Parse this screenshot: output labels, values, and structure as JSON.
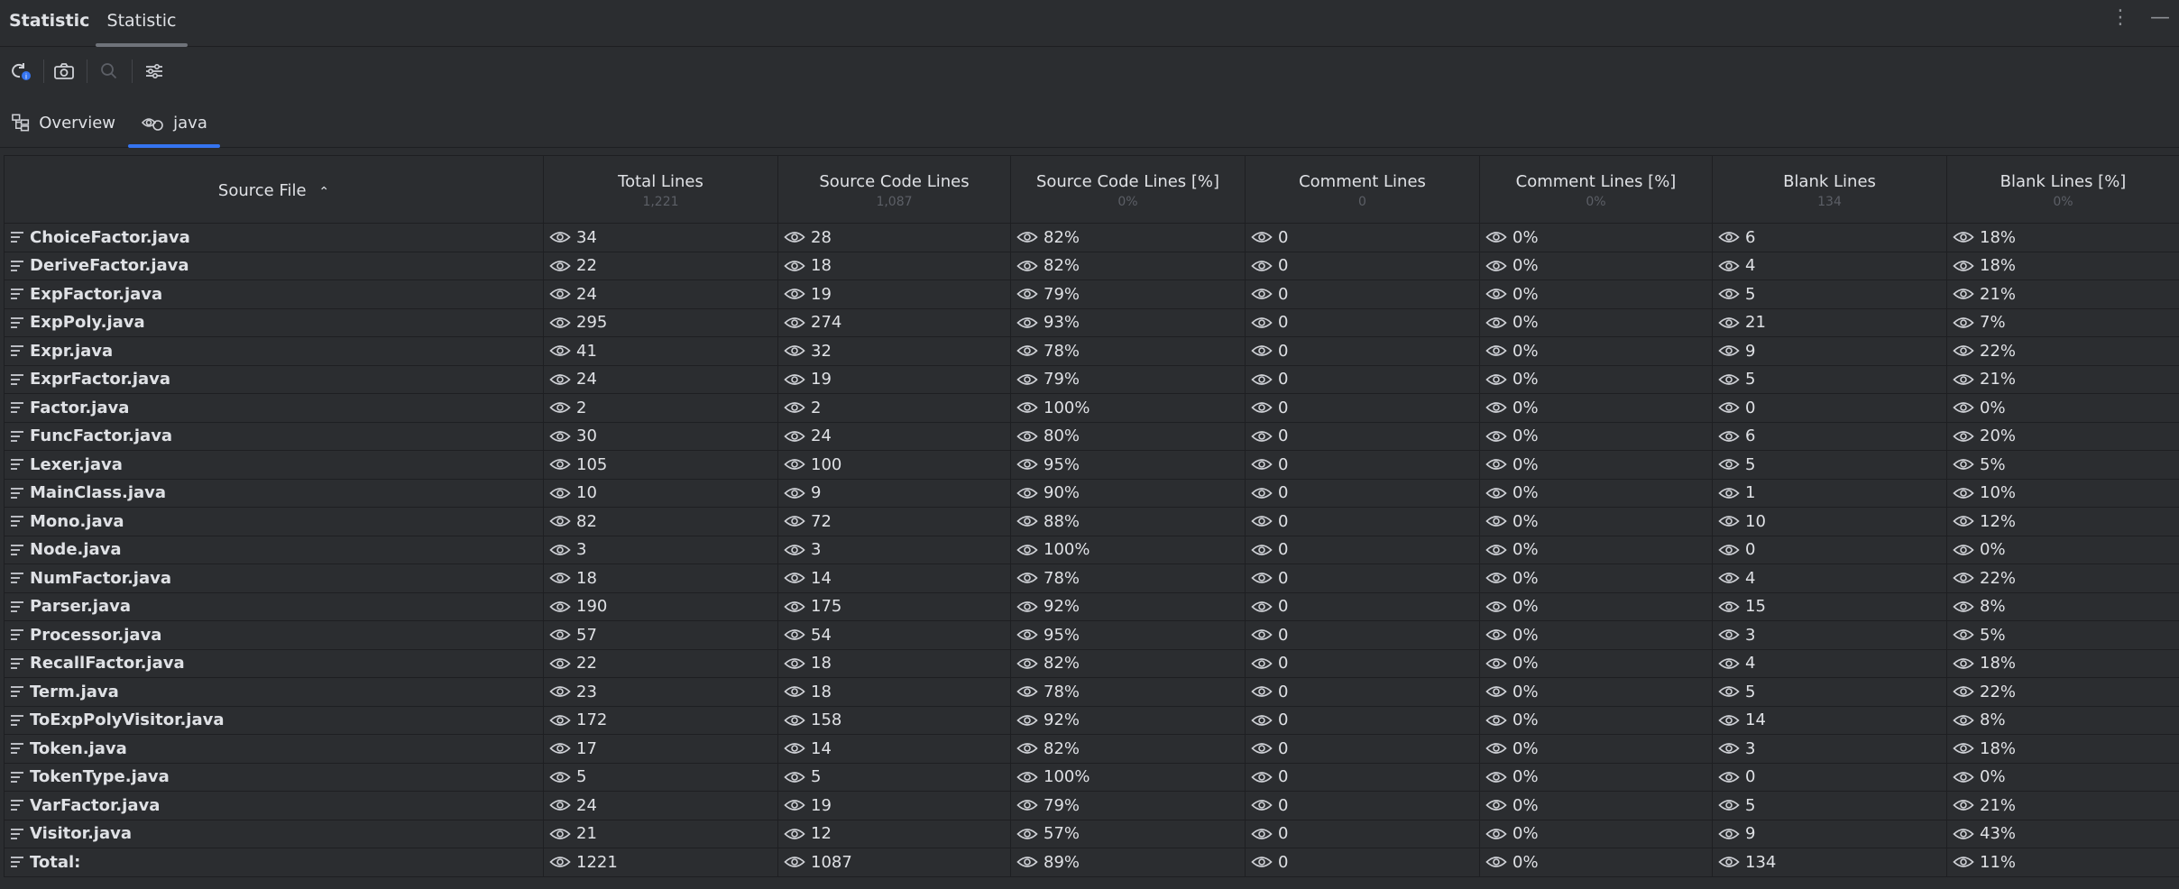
{
  "window": {
    "title": "Statistic",
    "tab": "Statistic",
    "more_icon": "more-vertical-icon",
    "minimize_icon": "minimize-icon"
  },
  "toolbar": {
    "refresh_icon": "refresh-icon",
    "snapshot_icon": "camera-icon",
    "search_icon": "search-icon",
    "settings_icon": "sliders-icon"
  },
  "subtabs": {
    "overview": "Overview",
    "java": "java"
  },
  "accent": "#3574f0",
  "table": {
    "headers": {
      "source_file": "Source File",
      "total_lines": "Total Lines",
      "total_lines_sub": "1,221",
      "source_code_lines": "Source Code Lines",
      "source_code_lines_sub": "1,087",
      "source_code_pct": "Source Code Lines [%]",
      "source_code_pct_sub": "0%",
      "comment_lines": "Comment Lines",
      "comment_lines_sub": "0",
      "comment_pct": "Comment Lines [%]",
      "comment_pct_sub": "0%",
      "blank_lines": "Blank Lines",
      "blank_lines_sub": "134",
      "blank_pct": "Blank Lines [%]",
      "blank_pct_sub": "0%"
    },
    "rows": [
      {
        "file": "ChoiceFactor.java",
        "total": "34",
        "src": "28",
        "src_pct": "82%",
        "com": "0",
        "com_pct": "0%",
        "blank": "6",
        "blank_pct": "18%"
      },
      {
        "file": "DeriveFactor.java",
        "total": "22",
        "src": "18",
        "src_pct": "82%",
        "com": "0",
        "com_pct": "0%",
        "blank": "4",
        "blank_pct": "18%"
      },
      {
        "file": "ExpFactor.java",
        "total": "24",
        "src": "19",
        "src_pct": "79%",
        "com": "0",
        "com_pct": "0%",
        "blank": "5",
        "blank_pct": "21%"
      },
      {
        "file": "ExpPoly.java",
        "total": "295",
        "src": "274",
        "src_pct": "93%",
        "com": "0",
        "com_pct": "0%",
        "blank": "21",
        "blank_pct": "7%"
      },
      {
        "file": "Expr.java",
        "total": "41",
        "src": "32",
        "src_pct": "78%",
        "com": "0",
        "com_pct": "0%",
        "blank": "9",
        "blank_pct": "22%"
      },
      {
        "file": "ExprFactor.java",
        "total": "24",
        "src": "19",
        "src_pct": "79%",
        "com": "0",
        "com_pct": "0%",
        "blank": "5",
        "blank_pct": "21%"
      },
      {
        "file": "Factor.java",
        "total": "2",
        "src": "2",
        "src_pct": "100%",
        "com": "0",
        "com_pct": "0%",
        "blank": "0",
        "blank_pct": "0%"
      },
      {
        "file": "FuncFactor.java",
        "total": "30",
        "src": "24",
        "src_pct": "80%",
        "com": "0",
        "com_pct": "0%",
        "blank": "6",
        "blank_pct": "20%"
      },
      {
        "file": "Lexer.java",
        "total": "105",
        "src": "100",
        "src_pct": "95%",
        "com": "0",
        "com_pct": "0%",
        "blank": "5",
        "blank_pct": "5%"
      },
      {
        "file": "MainClass.java",
        "total": "10",
        "src": "9",
        "src_pct": "90%",
        "com": "0",
        "com_pct": "0%",
        "blank": "1",
        "blank_pct": "10%"
      },
      {
        "file": "Mono.java",
        "total": "82",
        "src": "72",
        "src_pct": "88%",
        "com": "0",
        "com_pct": "0%",
        "blank": "10",
        "blank_pct": "12%"
      },
      {
        "file": "Node.java",
        "total": "3",
        "src": "3",
        "src_pct": "100%",
        "com": "0",
        "com_pct": "0%",
        "blank": "0",
        "blank_pct": "0%"
      },
      {
        "file": "NumFactor.java",
        "total": "18",
        "src": "14",
        "src_pct": "78%",
        "com": "0",
        "com_pct": "0%",
        "blank": "4",
        "blank_pct": "22%"
      },
      {
        "file": "Parser.java",
        "total": "190",
        "src": "175",
        "src_pct": "92%",
        "com": "0",
        "com_pct": "0%",
        "blank": "15",
        "blank_pct": "8%"
      },
      {
        "file": "Processor.java",
        "total": "57",
        "src": "54",
        "src_pct": "95%",
        "com": "0",
        "com_pct": "0%",
        "blank": "3",
        "blank_pct": "5%"
      },
      {
        "file": "RecallFactor.java",
        "total": "22",
        "src": "18",
        "src_pct": "82%",
        "com": "0",
        "com_pct": "0%",
        "blank": "4",
        "blank_pct": "18%"
      },
      {
        "file": "Term.java",
        "total": "23",
        "src": "18",
        "src_pct": "78%",
        "com": "0",
        "com_pct": "0%",
        "blank": "5",
        "blank_pct": "22%"
      },
      {
        "file": "ToExpPolyVisitor.java",
        "total": "172",
        "src": "158",
        "src_pct": "92%",
        "com": "0",
        "com_pct": "0%",
        "blank": "14",
        "blank_pct": "8%"
      },
      {
        "file": "Token.java",
        "total": "17",
        "src": "14",
        "src_pct": "82%",
        "com": "0",
        "com_pct": "0%",
        "blank": "3",
        "blank_pct": "18%"
      },
      {
        "file": "TokenType.java",
        "total": "5",
        "src": "5",
        "src_pct": "100%",
        "com": "0",
        "com_pct": "0%",
        "blank": "0",
        "blank_pct": "0%"
      },
      {
        "file": "VarFactor.java",
        "total": "24",
        "src": "19",
        "src_pct": "79%",
        "com": "0",
        "com_pct": "0%",
        "blank": "5",
        "blank_pct": "21%"
      },
      {
        "file": "Visitor.java",
        "total": "21",
        "src": "12",
        "src_pct": "57%",
        "com": "0",
        "com_pct": "0%",
        "blank": "9",
        "blank_pct": "43%"
      },
      {
        "file": "Total:",
        "total": "1221",
        "src": "1087",
        "src_pct": "89%",
        "com": "0",
        "com_pct": "0%",
        "blank": "134",
        "blank_pct": "11%"
      }
    ]
  }
}
